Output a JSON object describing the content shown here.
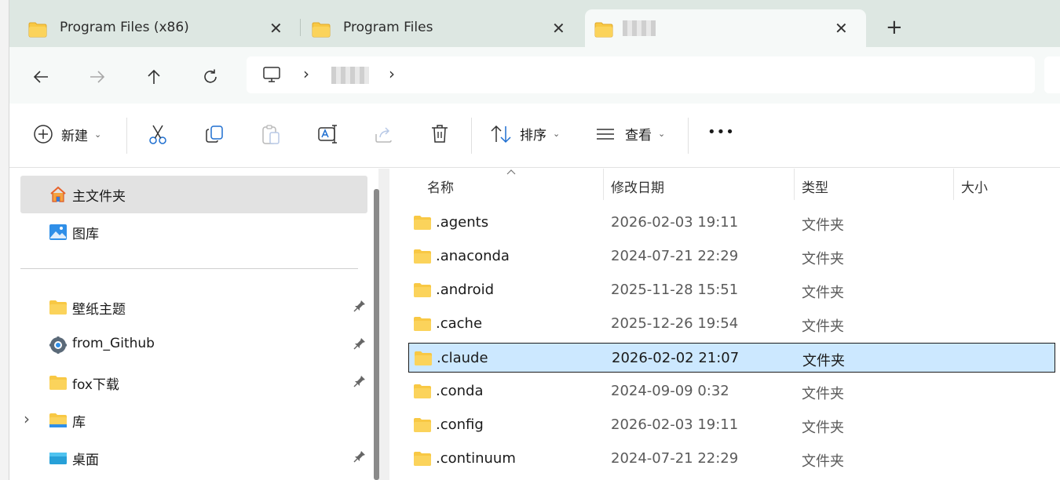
{
  "tabs": [
    {
      "label": "Program Files (x86)",
      "close": "✕"
    },
    {
      "label": "Program Files",
      "close": "✕"
    },
    {
      "label": "",
      "close": "✕"
    }
  ],
  "tab_add": "+",
  "nav": {
    "back": "back-arrow",
    "forward": "forward-arrow",
    "up": "up-arrow",
    "refresh": "refresh"
  },
  "address": {
    "separator1": "›",
    "separator2": "›"
  },
  "command_bar": {
    "new_label": "新建",
    "sort_label": "排序",
    "view_label": "查看",
    "more": "•••"
  },
  "sidebar": {
    "items": [
      {
        "label": "主文件夹",
        "icon": "home-icon"
      },
      {
        "label": "图库",
        "icon": "gallery-icon"
      },
      {
        "label": "壁纸主题",
        "icon": "folder-icon",
        "pinned": true
      },
      {
        "label": "from_Github",
        "icon": "github-icon",
        "pinned": true
      },
      {
        "label": "fox下载",
        "icon": "folder-icon",
        "pinned": true
      },
      {
        "label": "库",
        "icon": "library-icon",
        "expand": "›"
      },
      {
        "label": "桌面",
        "icon": "desktop-icon",
        "pinned": true
      }
    ]
  },
  "file_list": {
    "columns": [
      "名称",
      "修改日期",
      "类型",
      "大小"
    ],
    "rows": [
      {
        "name": ".agents",
        "date": "2026-02-03 19:11",
        "type": "文件夹"
      },
      {
        "name": ".anaconda",
        "date": "2024-07-21 22:29",
        "type": "文件夹"
      },
      {
        "name": ".android",
        "date": "2025-11-28 15:51",
        "type": "文件夹"
      },
      {
        "name": ".cache",
        "date": "2025-12-26 19:54",
        "type": "文件夹"
      },
      {
        "name": ".claude",
        "date": "2026-02-02 21:07",
        "type": "文件夹",
        "selected": true
      },
      {
        "name": ".conda",
        "date": "2024-09-09 0:32",
        "type": "文件夹"
      },
      {
        "name": ".config",
        "date": "2026-02-03 19:11",
        "type": "文件夹"
      },
      {
        "name": ".continuum",
        "date": "2024-07-21 22:29",
        "type": "文件夹"
      }
    ]
  },
  "colors": {
    "tab_strip": "#dde7e2",
    "selection": "#cce8ff",
    "folder": "#f8c844"
  }
}
